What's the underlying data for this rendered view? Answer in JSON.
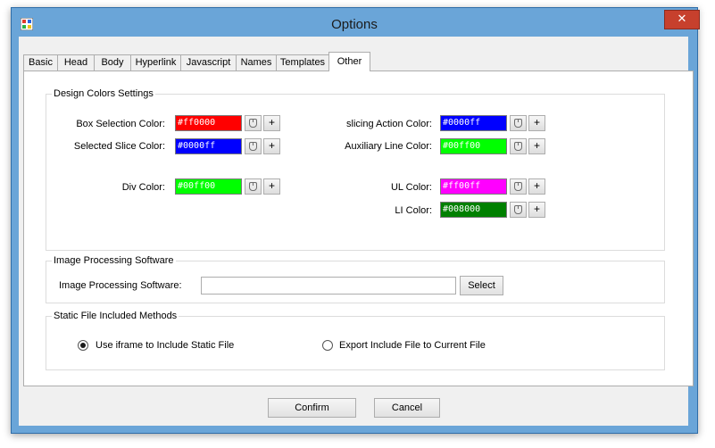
{
  "window": {
    "title": "Options",
    "close_glyph": "✕"
  },
  "tabs": [
    {
      "label": "Basic"
    },
    {
      "label": "Head"
    },
    {
      "label": "Body"
    },
    {
      "label": "Hyperlink"
    },
    {
      "label": "Javascript"
    },
    {
      "label": "Names"
    },
    {
      "label": "Templates"
    },
    {
      "label": "Other",
      "active": true
    }
  ],
  "design_colors": {
    "legend": "Design Colors Settings",
    "box_selection": {
      "label": "Box Selection Color:",
      "value": "#ff0000",
      "color": "#ff0000"
    },
    "selected_slice": {
      "label": "Selected Slice Color:",
      "value": "#0000ff",
      "color": "#0000ff"
    },
    "div": {
      "label": "Div Color:",
      "value": "#00ff00",
      "color": "#00ff00"
    },
    "slicing_action": {
      "label": "slicing Action Color:",
      "value": "#0000ff",
      "color": "#0000ff"
    },
    "auxiliary_line": {
      "label": "Auxiliary Line Color:",
      "value": "#00ff00",
      "color": "#00ff00"
    },
    "ul": {
      "label": "UL Color:",
      "value": "#ff00ff",
      "color": "#ff00ff"
    },
    "li": {
      "label": "LI Color:",
      "value": "#008000",
      "color": "#008000"
    },
    "add_glyph": "+"
  },
  "image_software": {
    "legend": "Image Processing Software",
    "label": "Image Processing Software:",
    "value": "",
    "select_label": "Select"
  },
  "static_file": {
    "legend": "Static File Included Methods",
    "option_iframe": "Use iframe to Include Static File",
    "option_export": "Export Include File to Current File",
    "selected": "iframe"
  },
  "footer": {
    "confirm_label": "Confirm",
    "cancel_label": "Cancel"
  }
}
